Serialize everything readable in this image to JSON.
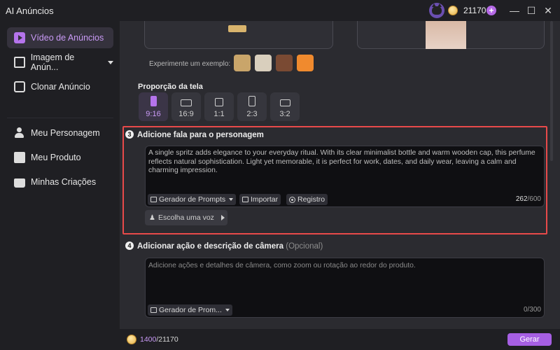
{
  "window": {
    "title": "AI Anúncios",
    "credits": "21170",
    "plus_label": "+",
    "minimize": "—",
    "maximize": "☐",
    "close": "✕"
  },
  "sidebar": {
    "items": [
      {
        "label": "Vídeo de Anúncios",
        "icon": "video-icon"
      },
      {
        "label": "Imagem de Anún...",
        "icon": "image-icon"
      },
      {
        "label": "Clonar Anúncio",
        "icon": "clone-icon"
      },
      {
        "label": "Meu Personagem",
        "icon": "person-icon"
      },
      {
        "label": "Meu Produto",
        "icon": "bag-icon"
      },
      {
        "label": "Minhas Criações",
        "icon": "folder-icon"
      }
    ]
  },
  "examples": {
    "label": "Experimente um exemplo:",
    "thumb_colors": [
      "#c9a56a",
      "#d9cfbd",
      "#7a4a33",
      "#f08a2e"
    ]
  },
  "ratio": {
    "title": "Proporção da tela",
    "options": [
      "9:16",
      "16:9",
      "1:1",
      "2:3",
      "3:2"
    ],
    "selected": "9:16"
  },
  "speech": {
    "step": "3",
    "title": "Adicione fala para o personagem",
    "text": "A single spritz adds elegance to your everyday ritual. With its clear minimalist bottle and warm wooden cap, this perfume reflects natural sophistication. Light yet memorable, it is perfect for work, dates, and daily wear, leaving a calm and charming impression.",
    "prompt_gen": "Gerador de Prompts",
    "import": "Importar",
    "record": "Registro",
    "count": "262",
    "max": "/600",
    "voice": "Escolha uma voz"
  },
  "action": {
    "step": "4",
    "title": "Adicionar ação e descrição de câmera",
    "optional": "(Opcional)",
    "placeholder": "Adicione ações e detalhes de câmera, como zoom ou rotação ao redor do produto.",
    "prompt_gen": "Gerador de Prom...",
    "count": "0",
    "max": "/300"
  },
  "footer": {
    "used": "1400",
    "total": "/21170",
    "generate": "Gerar"
  },
  "colors": {
    "accent": "#a65fe3",
    "highlight": "#e84a4a"
  }
}
